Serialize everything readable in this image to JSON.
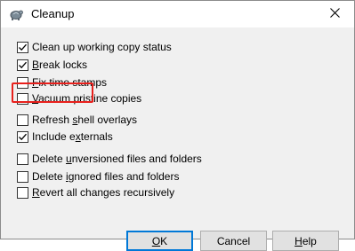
{
  "window": {
    "title": "Cleanup",
    "close_icon": "close-icon",
    "app_icon": "tortoise-icon"
  },
  "options": [
    {
      "id": "clean-up-working-copy-status",
      "label_pre": "Clean up working copy status",
      "mnemonic": "",
      "label_post": "",
      "checked": true
    },
    {
      "id": "break-locks",
      "label_pre": "",
      "mnemonic": "B",
      "label_post": "reak locks",
      "checked": true
    },
    {
      "id": "fix-time-stamps",
      "label_pre": "",
      "mnemonic": "F",
      "label_post": "ix time stamps",
      "checked": false
    },
    {
      "id": "vacuum-pristine-copies",
      "label_pre": "",
      "mnemonic": "V",
      "label_post": "acuum pristine copies",
      "checked": false
    },
    {
      "id": "refresh-shell-overlays",
      "label_pre": "Refresh ",
      "mnemonic": "s",
      "label_post": "hell overlays",
      "checked": false
    },
    {
      "id": "include-externals",
      "label_pre": "Include e",
      "mnemonic": "x",
      "label_post": "ternals",
      "checked": true
    },
    {
      "id": "delete-unversioned",
      "label_pre": "Delete ",
      "mnemonic": "u",
      "label_post": "nversioned files and folders",
      "checked": false
    },
    {
      "id": "delete-ignored",
      "label_pre": "Delete ",
      "mnemonic": "i",
      "label_post": "gnored files and folders",
      "checked": false
    },
    {
      "id": "revert-all-changes",
      "label_pre": "",
      "mnemonic": "R",
      "label_post": "evert all changes recursively",
      "checked": false
    }
  ],
  "buttons": {
    "ok": {
      "pre": "",
      "mnemonic": "O",
      "post": "K"
    },
    "cancel": {
      "pre": "Cancel",
      "mnemonic": "",
      "post": ""
    },
    "help": {
      "pre": "",
      "mnemonic": "H",
      "post": "elp"
    }
  },
  "colors": {
    "highlight": "#e8201c",
    "default_button_border": "#0078d7"
  }
}
